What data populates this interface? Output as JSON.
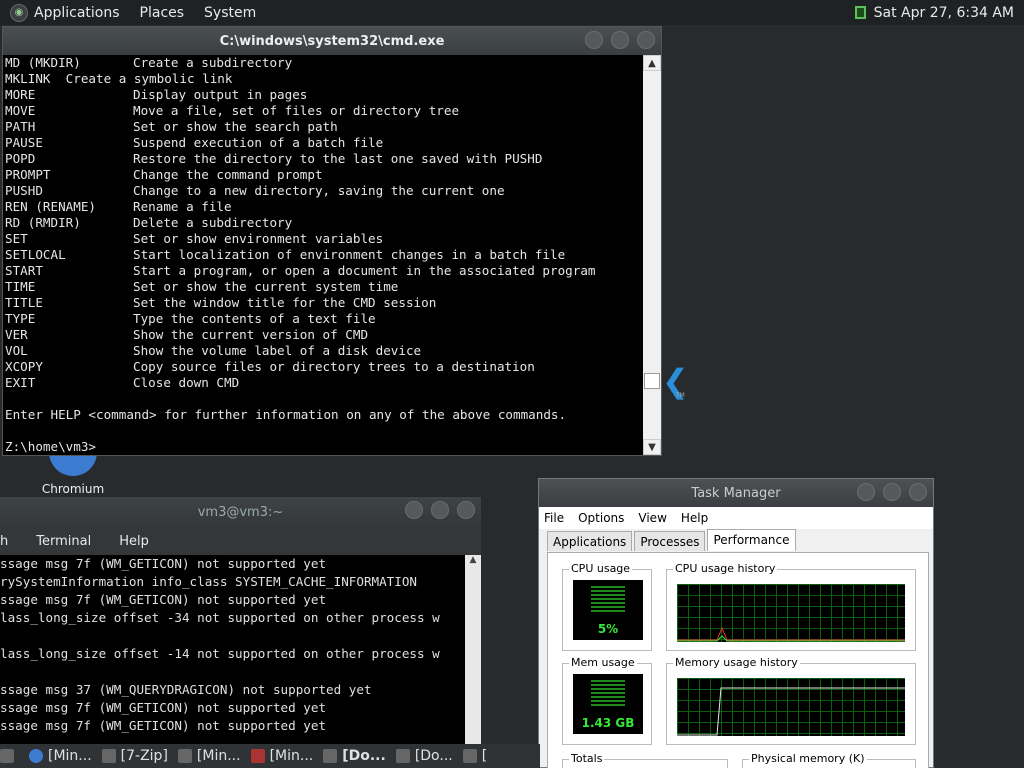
{
  "top_panel": {
    "menus": [
      "Applications",
      "Places",
      "System"
    ],
    "clock": "Sat Apr 27,  6:34 AM"
  },
  "desktop": {
    "chromium_label": "Chromium"
  },
  "cmd": {
    "title": "C:\\windows\\system32\\cmd.exe",
    "rows": [
      [
        "MD (MKDIR)",
        "Create a subdirectory"
      ],
      [
        "MKLINK  Create a symbolic link",
        ""
      ],
      [
        "MORE",
        "Display output in pages"
      ],
      [
        "MOVE",
        "Move a file, set of files or directory tree"
      ],
      [
        "PATH",
        "Set or show the search path"
      ],
      [
        "PAUSE",
        "Suspend execution of a batch file"
      ],
      [
        "POPD",
        "Restore the directory to the last one saved with PUSHD"
      ],
      [
        "PROMPT",
        "Change the command prompt"
      ],
      [
        "PUSHD",
        "Change to a new directory, saving the current one"
      ],
      [
        "REN (RENAME)",
        "Rename a file"
      ],
      [
        "RD (RMDIR)",
        "Delete a subdirectory"
      ],
      [
        "SET",
        "Set or show environment variables"
      ],
      [
        "SETLOCAL",
        "Start localization of environment changes in a batch file"
      ],
      [
        "START",
        "Start a program, or open a document in the associated program"
      ],
      [
        "TIME",
        "Set or show the current system time"
      ],
      [
        "TITLE",
        "Set the window title for the CMD session"
      ],
      [
        "TYPE",
        "Type the contents of a text file"
      ],
      [
        "VER",
        "Show the current version of CMD"
      ],
      [
        "VOL",
        "Show the volume label of a disk device"
      ],
      [
        "XCOPY",
        "Copy source files or directory trees to a destination"
      ],
      [
        "EXIT",
        "Close down CMD"
      ],
      [
        "",
        ""
      ],
      [
        "Enter HELP <command> for further information on any of the above commands.",
        ""
      ],
      [
        "",
        ""
      ],
      [
        "Z:\\home\\vm3>",
        ""
      ]
    ]
  },
  "terminal": {
    "title": "vm3@vm3:~",
    "menus": [
      "h",
      "Terminal",
      "Help"
    ],
    "lines": [
      "ssage msg 7f (WM_GETICON) not supported yet",
      "rySystemInformation info_class SYSTEM_CACHE_INFORMATION",
      "ssage msg 7f (WM_GETICON) not supported yet",
      "lass_long_size offset -34 not supported on other process w",
      "",
      "lass_long_size offset -14 not supported on other process w",
      "",
      "ssage msg 37 (WM_QUERYDRAGICON) not supported yet",
      "ssage msg 7f (WM_GETICON) not supported yet",
      "ssage msg 7f (WM_GETICON) not supported yet"
    ]
  },
  "task_manager": {
    "title": "Task Manager",
    "menus": [
      "File",
      "Options",
      "View",
      "Help"
    ],
    "tabs": [
      "Applications",
      "Processes",
      "Performance"
    ],
    "active_tab": "Performance",
    "cpu_usage_label": "CPU usage",
    "cpu_usage_value": "5%",
    "cpu_history_label": "CPU usage history",
    "mem_usage_label": "Mem usage",
    "mem_usage_value": "1.43 GB",
    "mem_history_label": "Memory usage history",
    "totals_label": "Totals",
    "physical_label": "Physical memory (K)"
  },
  "taskbar": {
    "items": [
      "[Min...",
      "[7-Zip]",
      "[Min...",
      "[Min...",
      "[Do...",
      "[Do...",
      "["
    ]
  }
}
